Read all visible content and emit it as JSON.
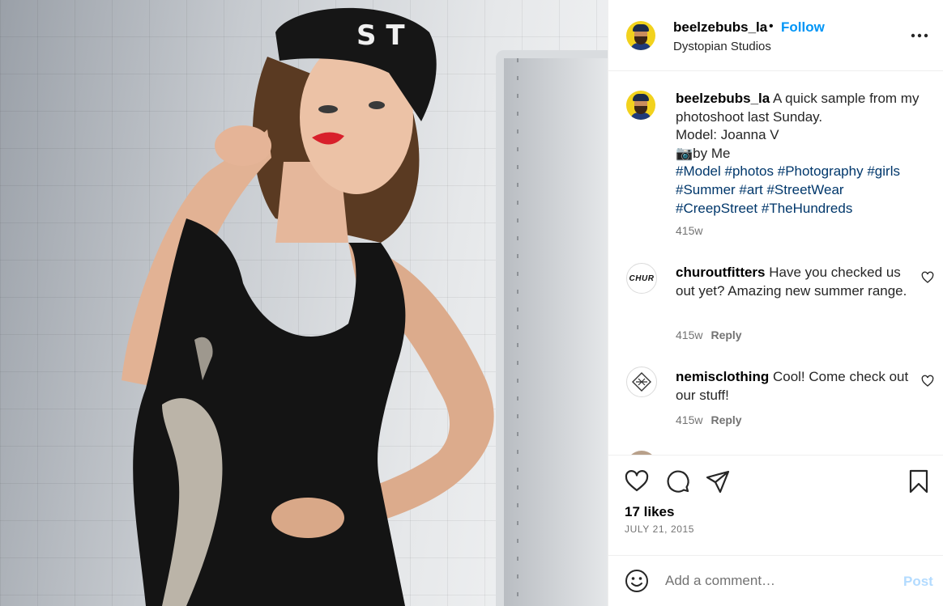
{
  "post": {
    "username": "beelzebubs_la",
    "separator": "•",
    "follow_label": "Follow",
    "location": "Dystopian Studios"
  },
  "caption": {
    "username": "beelzebubs_la",
    "line1": "A quick sample from my photoshoot last Sunday.",
    "line2": "Model: Joanna V",
    "camera_emoji": "📷",
    "line3": "by Me",
    "hashtags": [
      "#Model",
      "#photos",
      "#Photography",
      "#girls",
      "#Summer",
      "#art",
      "#StreetWear",
      "#CreepStreet",
      "#TheHundreds"
    ],
    "time": "415w"
  },
  "comments": [
    {
      "username": "churoutfitters",
      "avatar_text": "CHUR",
      "text": "Have you checked us out yet? Amazing new summer range.",
      "time": "415w",
      "reply_label": "Reply"
    },
    {
      "username": "nemisclothing",
      "avatar_text": "",
      "text": "Cool! Come check out our stuff!",
      "time": "415w",
      "reply_label": "Reply"
    }
  ],
  "actions": {
    "icons": [
      "heart-icon",
      "comment-icon",
      "share-icon",
      "bookmark-icon"
    ]
  },
  "likes": "17 likes",
  "date": "JULY 21, 2015",
  "add_comment": {
    "placeholder": "Add a comment…",
    "post_label": "Post"
  },
  "colors": {
    "link_blue": "#0095f6",
    "hashtag_blue": "#00376b",
    "post_disabled": "#b3dbff",
    "muted_text": "#737373",
    "avatar_yellow": "#f2d21d"
  }
}
